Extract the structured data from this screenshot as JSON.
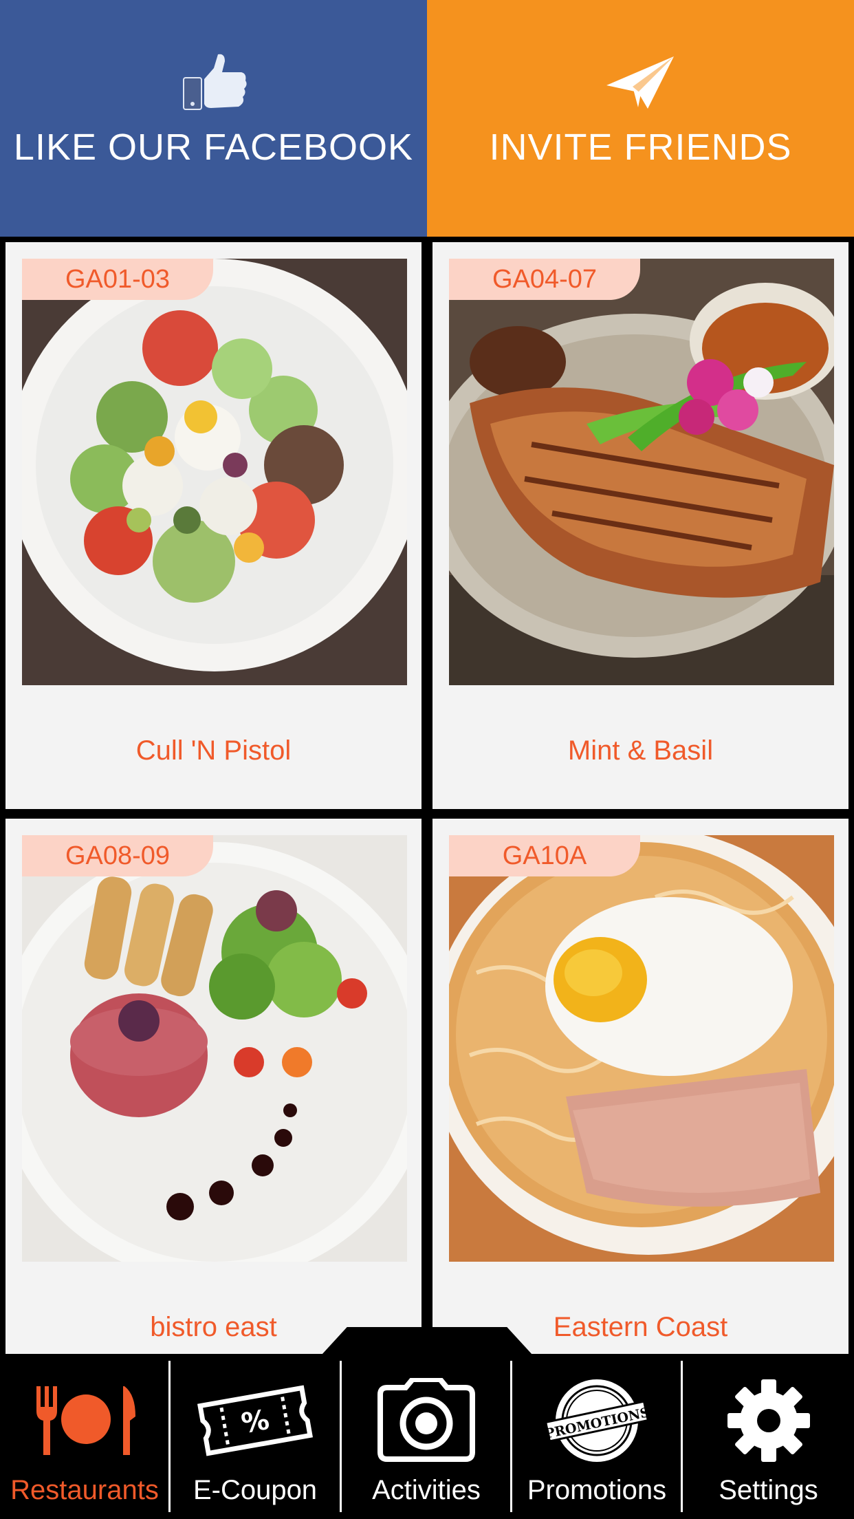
{
  "hero": {
    "facebook": {
      "label": "LIKE OUR FACEBOOK",
      "color": "#3b5998",
      "icon": "thumbs-up-icon"
    },
    "invite": {
      "label": "INVITE FRIENDS",
      "color": "#f5921e",
      "icon": "paper-plane-icon"
    }
  },
  "colors": {
    "accent": "#f05a2a",
    "tag_bg": "#fcd3c6",
    "card_bg": "#f3f3f3",
    "tabbar_bg": "#000000"
  },
  "restaurants": [
    {
      "code": "GA01-03",
      "name": "Cull 'N Pistol"
    },
    {
      "code": "GA04-07",
      "name": "Mint & Basil"
    },
    {
      "code": "GA08-09",
      "name": "bistro east"
    },
    {
      "code": "GA10A",
      "name": "Eastern Coast"
    }
  ],
  "tabs": [
    {
      "label": "Restaurants",
      "icon": "fork-plate-knife-icon",
      "active": true
    },
    {
      "label": "E-Coupon",
      "icon": "coupon-ticket-icon",
      "active": false
    },
    {
      "label": "Activities",
      "icon": "camera-icon",
      "active": false
    },
    {
      "label": "Promotions",
      "icon": "promotions-badge-icon",
      "active": false
    },
    {
      "label": "Settings",
      "icon": "gear-icon",
      "active": false
    }
  ],
  "promotions_badge_text": "PROMOTIONS"
}
